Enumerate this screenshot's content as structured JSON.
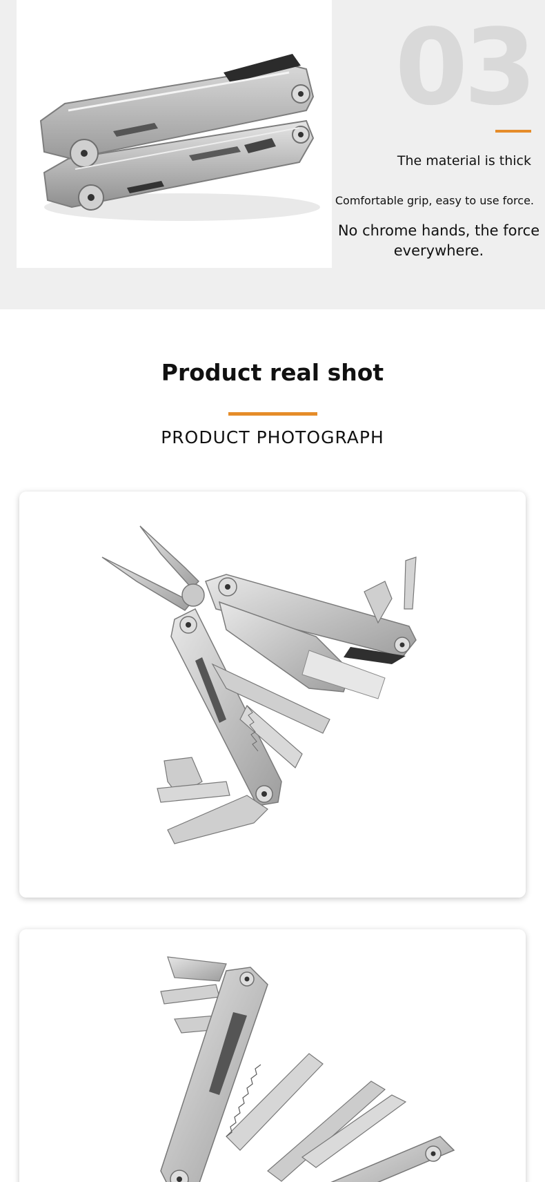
{
  "feature": {
    "number": "03",
    "title": "The material is thick",
    "subtitle": "Comfortable grip, easy to use force.",
    "description": "No chrome hands, the force everywhere.",
    "accent_color": "#e58c2a",
    "photo_label": "folded multitool"
  },
  "section": {
    "title": "Product real shot",
    "subtitle": "PRODUCT PHOTOGRAPH"
  },
  "photos": [
    {
      "label": "multitool opened with pliers and blades"
    },
    {
      "label": "multitool opened with saw, file and openers"
    }
  ]
}
